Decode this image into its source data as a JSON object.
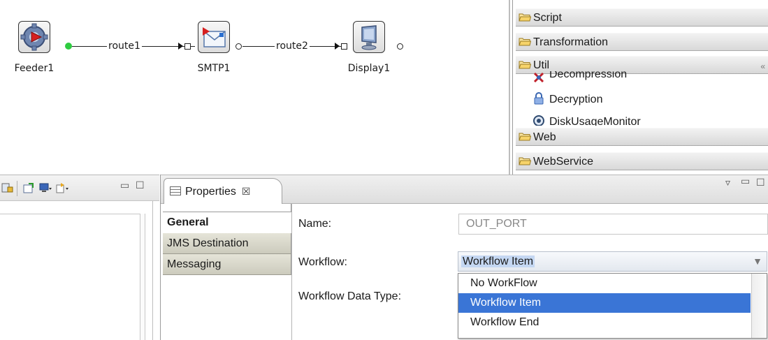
{
  "canvas": {
    "nodes": [
      {
        "label": "Feeder1",
        "icon": "feeder-gear-icon"
      },
      {
        "label": "SMTP1",
        "icon": "smtp-mail-icon"
      },
      {
        "label": "Display1",
        "icon": "display-monitor-icon"
      }
    ],
    "routes": [
      {
        "label": "route1"
      },
      {
        "label": "route2"
      }
    ]
  },
  "palette": {
    "drawers": [
      "Script",
      "Transformation",
      "Util",
      "Web",
      "WebService"
    ],
    "util_items": [
      {
        "label": "Decompression",
        "icon": "decompression-icon"
      },
      {
        "label": "Decryption",
        "icon": "lock-icon"
      },
      {
        "label": "DiskUsageMonitor",
        "icon": "disk-usage-icon"
      }
    ],
    "collapse_icon": "collapse-chevron-icon"
  },
  "properties": {
    "tab_label": "Properties",
    "tab_close": "☒",
    "categories": [
      "General",
      "JMS Destination",
      "Messaging"
    ],
    "active_category": "General",
    "fields": {
      "name_label": "Name:",
      "name_value": "OUT_PORT",
      "workflow_label": "Workflow:",
      "workflow_value": "Workflow Item",
      "workflow_data_type_label": "Workflow Data Type:"
    },
    "workflow_options": [
      "No WorkFlow",
      "Workflow Item",
      "Workflow End"
    ],
    "selected_option": "Workflow Item"
  },
  "colors": {
    "selection": "#3a75d6",
    "route_active_port": "#2ecc40",
    "category_bg": "#d6d5c8"
  }
}
